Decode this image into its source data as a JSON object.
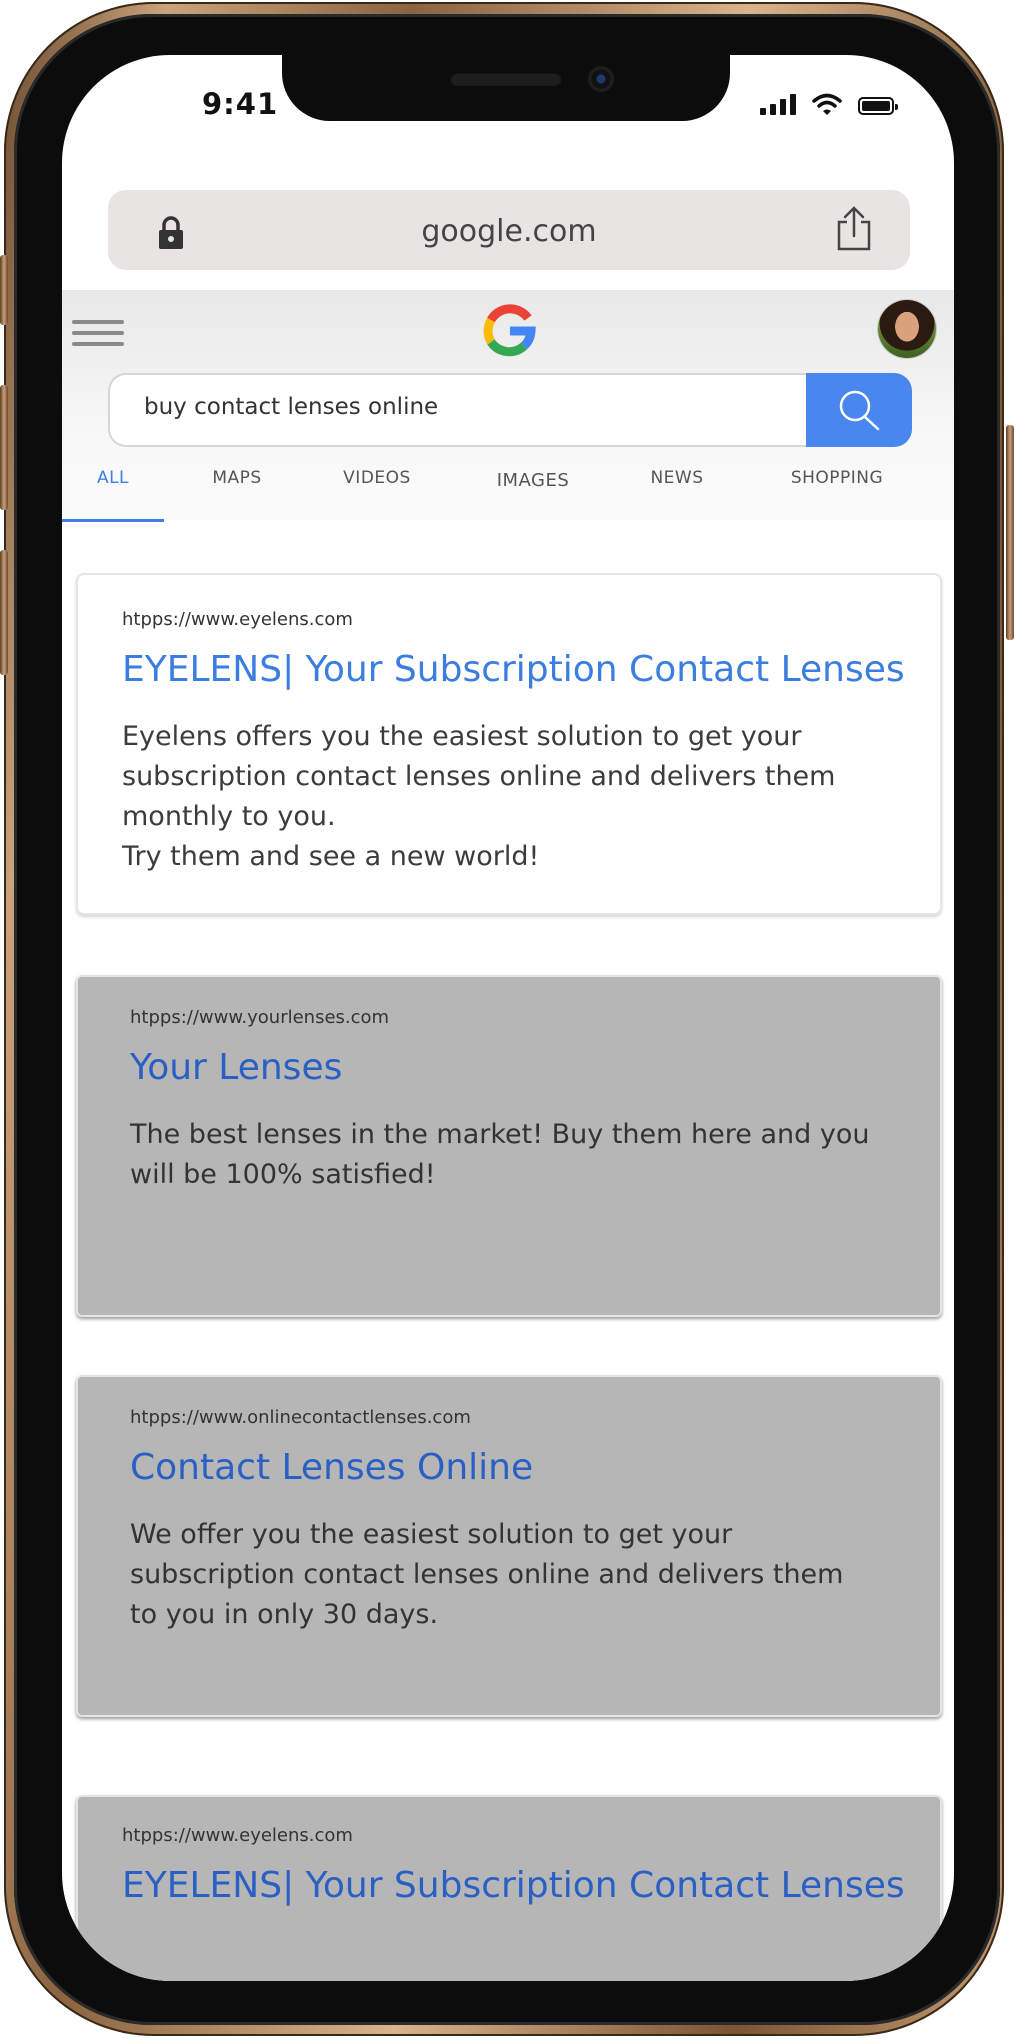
{
  "status_bar": {
    "time": "9:41"
  },
  "browser": {
    "url": "google.com"
  },
  "search": {
    "query": "buy contact lenses online"
  },
  "tabs": [
    {
      "label": "ALL",
      "active": true
    },
    {
      "label": "MAPS"
    },
    {
      "label": "VIDEOS"
    },
    {
      "label": "IMAGES"
    },
    {
      "label": "NEWS"
    },
    {
      "label": "SHOPPING"
    }
  ],
  "results": [
    {
      "url": "htpps://www.eyelens.com",
      "title": "EYELENS| Your Subscription Contact Lenses",
      "description": "Eyelens offers you the easiest solution to get your\nsubscription contact lenses online and delivers them\nmonthly to you.\nTry them and see a new world!"
    },
    {
      "url": "htpps://www.yourlenses.com",
      "title": "Your Lenses",
      "description": "The best lenses in the market! Buy them here and you\nwill be 100% satisfied!"
    },
    {
      "url": "htpps://www.onlinecontactlenses.com",
      "title": "Contact Lenses Online",
      "description": "We offer you the easiest solution to get your\nsubscription contact lenses online and delivers them\nto you in only 30 days."
    },
    {
      "url": "htpps://www.eyelens.com",
      "title": "EYELENS| Your Subscription Contact Lenses"
    }
  ],
  "colors": {
    "accent_blue": "#3b82e6",
    "search_button": "#4a86f0",
    "ad_card_grey": "#b6b6b6"
  },
  "icons": [
    "lock-icon",
    "share-icon",
    "menu-icon",
    "google-logo",
    "search-icon",
    "signal-icon",
    "wifi-icon",
    "battery-icon"
  ]
}
